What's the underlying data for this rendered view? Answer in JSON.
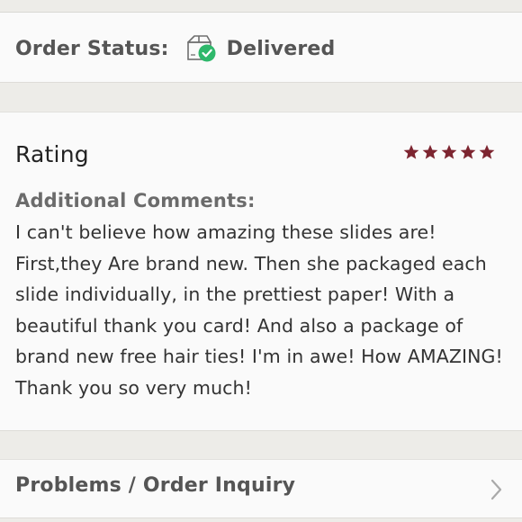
{
  "order_status": {
    "label": "Order Status:",
    "value": "Delivered",
    "icon": "delivered-box-icon"
  },
  "rating": {
    "title": "Rating",
    "stars": 5,
    "max_stars": 5,
    "star_color": "#7d2530"
  },
  "comments": {
    "label": "Additional Comments:",
    "text": "I can't believe how amazing these slides are! First,they Are brand new. Then she packaged each slide individually, in the prettiest paper! With a beautiful thank you card! And also a package of brand new free hair ties! I'm in awe! How AMAZING! Thank you so very much!"
  },
  "inquiry": {
    "label": "Problems / Order Inquiry",
    "icon": "chevron-right-icon"
  },
  "colors": {
    "check_green": "#2eb86b",
    "background": "#edece8",
    "card": "#fafafa"
  }
}
